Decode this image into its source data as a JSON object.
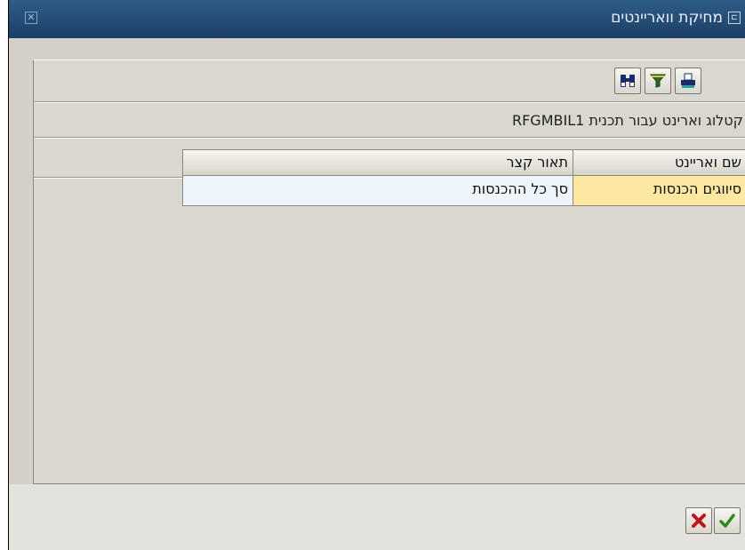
{
  "window": {
    "title": "מחיקת וואריינטים"
  },
  "toolbar": {
    "buttons": [
      {
        "id": "print",
        "icon": "print-icon"
      },
      {
        "id": "filter",
        "icon": "filter-icon"
      },
      {
        "id": "find",
        "icon": "binoculars-icon"
      }
    ]
  },
  "caption": "קטלוג וארינט עבור תכנית RFGMBIL1",
  "table": {
    "columns": [
      "שם ואריינט",
      "תאור קצר"
    ],
    "rows": [
      {
        "variant_name": "סיווגים הכנסות",
        "description": "סך כל ההכנסות"
      }
    ]
  },
  "actions": {
    "confirm_icon": "check-icon",
    "cancel_icon": "cancel-x-icon"
  },
  "colors": {
    "title_bar": "#1f4670",
    "selected_cell": "#fde8a2",
    "row_cell": "#eef5fb",
    "panel": "#dad7cf"
  }
}
